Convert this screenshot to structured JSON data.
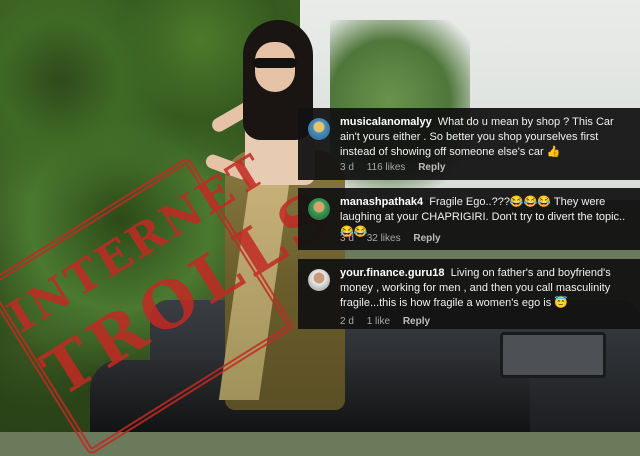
{
  "stamp": {
    "line1": "INTERNET",
    "line2": "TROLLS"
  },
  "comments": [
    {
      "username": "musicalanomalyy",
      "text": "What do u mean by shop ? This Car ain't yours either . So better you shop yourselves first instead of showing off someone else's car 👍",
      "time": "3 d",
      "likes": "116 likes",
      "reply": "Reply"
    },
    {
      "username": "manashpathak4",
      "text": "Fragile Ego..???😂😂😂 They were laughing at your CHAPRIGIRI. Don't try to divert the topic.. 😂😂",
      "time": "3 d",
      "likes": "32 likes",
      "reply": "Reply"
    },
    {
      "username": "your.finance.guru18",
      "text": "Living on father's and boyfriend's money , working for men , and then you call masculinity fragile...this is how fragile a women's ego is 😇",
      "time": "2 d",
      "likes": "1 like",
      "reply": "Reply"
    }
  ]
}
